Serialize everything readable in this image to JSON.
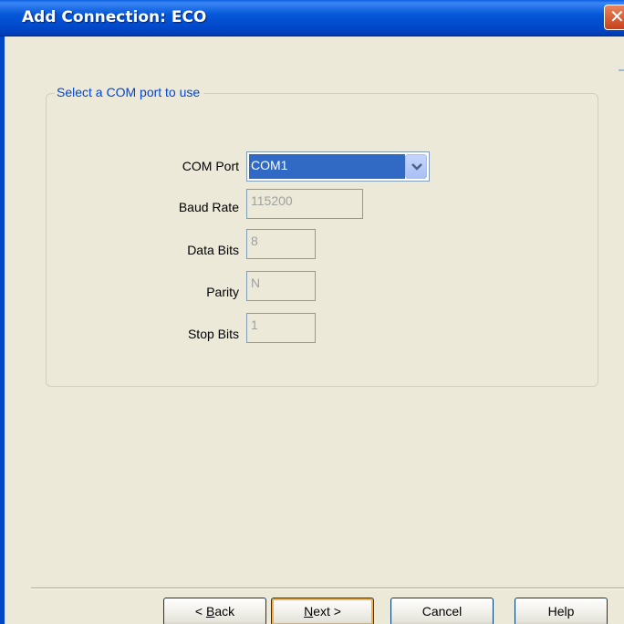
{
  "window": {
    "title": "Add Connection: ECO",
    "close_glyph": "✕"
  },
  "group": {
    "legend": "Select a COM port to use"
  },
  "fields": {
    "com_port": {
      "label": "COM Port",
      "value": "COM1"
    },
    "baud_rate": {
      "label": "Baud Rate",
      "value": "115200"
    },
    "data_bits": {
      "label": "Data Bits",
      "value": "8"
    },
    "parity": {
      "label": "Parity",
      "value": "N"
    },
    "stop_bits": {
      "label": "Stop Bits",
      "value": "1"
    }
  },
  "buttons": {
    "back_prefix": "< ",
    "back_accel": "B",
    "back_rest": "ack",
    "next_accel": "N",
    "next_rest": "ext >",
    "cancel": "Cancel",
    "help": "Help"
  },
  "colors": {
    "titlebar": "#0558d8",
    "selection": "#316ac5",
    "legend_text": "#0046d5",
    "dialog_bg": "#ece9d8"
  },
  "icons": {
    "close": "close-icon",
    "dropdown": "chevron-down-icon"
  }
}
